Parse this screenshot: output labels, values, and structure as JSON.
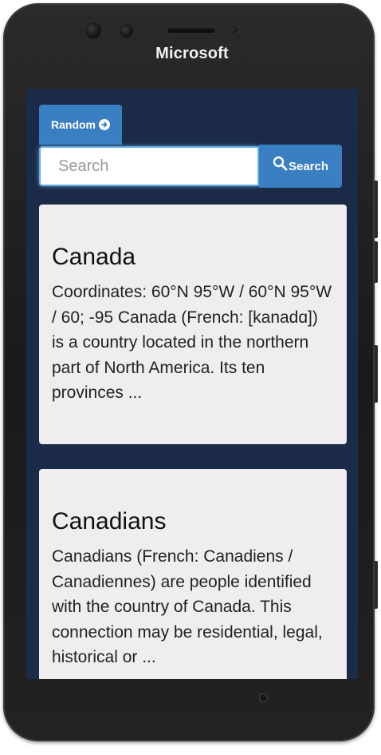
{
  "device": {
    "brand": "Microsoft"
  },
  "toolbar": {
    "random_label": "Random",
    "search_placeholder": "Search",
    "search_value": "",
    "search_button_label": "Search"
  },
  "results": [
    {
      "title": "Canada",
      "snippet": "Coordinates: 60°N 95°W / 60°N 95°W / 60; -95 Canada (French: [kanadɑ]) is a country located in the northern part of North America. Its ten provinces ..."
    },
    {
      "title": "Canadians",
      "snippet": "Canadians (French: Canadiens / Canadiennes) are people identified with the country of Canada. This connection may be residential, legal, historical or ..."
    }
  ],
  "colors": {
    "screen_background": "#1b2a47",
    "accent": "#3a7fc1",
    "card_background": "#eeeeee",
    "focus_ring": "#66afe9"
  },
  "icons": {
    "random_button": "arrow-circle-right-icon",
    "search_button": "magnifier-icon"
  }
}
